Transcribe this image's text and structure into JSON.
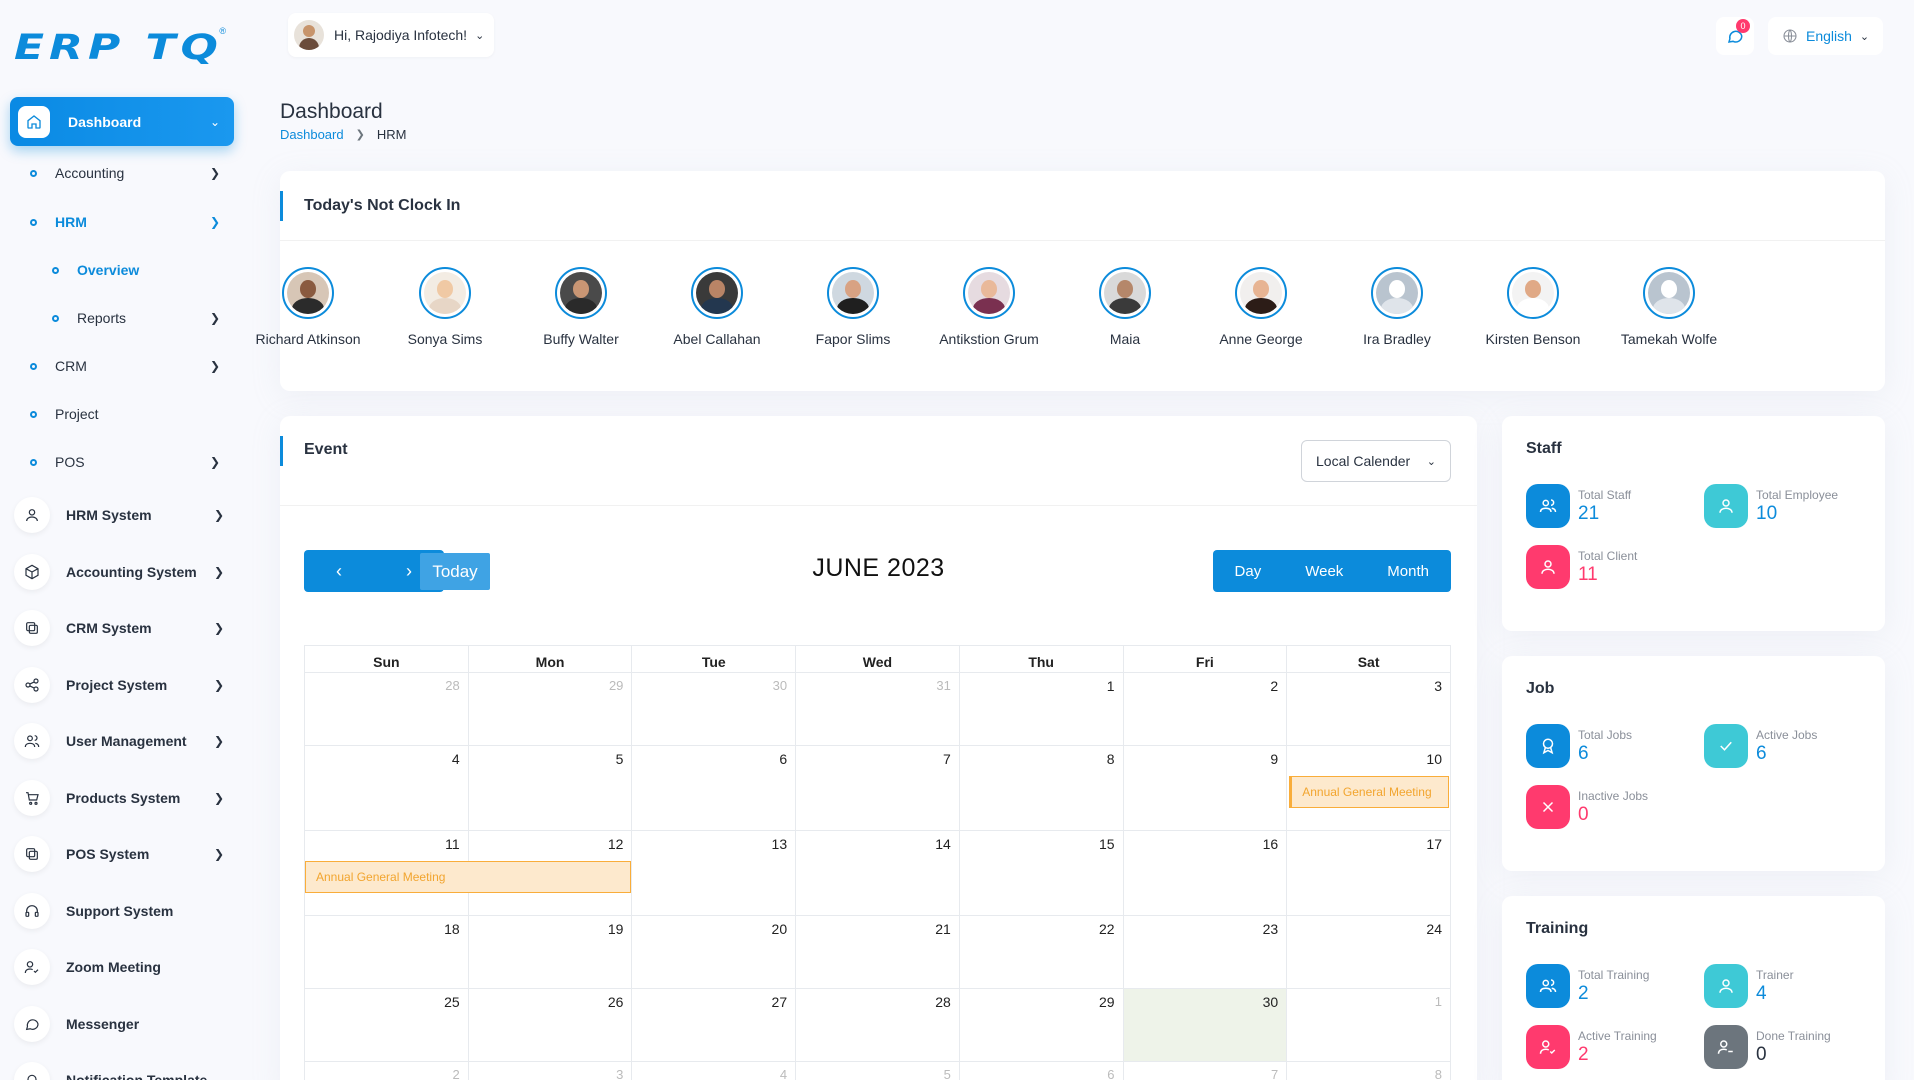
{
  "brand": {
    "logo_text": "ERP TQ",
    "reg": "®"
  },
  "sidebar": {
    "active": {
      "label": "Dashboard",
      "icon": "home-icon"
    },
    "subitems": [
      {
        "label": "Accounting",
        "chev": "›",
        "top": 0
      },
      {
        "label": "HRM",
        "chev": "⌄"
      },
      {
        "label": "Overview"
      },
      {
        "label": "Reports",
        "chev": "›"
      },
      {
        "label": "CRM",
        "chev": "›"
      },
      {
        "label": "Project"
      },
      {
        "label": "POS",
        "chev": "›"
      }
    ],
    "menus": [
      {
        "label": "HRM System",
        "icon": "user-icon"
      },
      {
        "label": "Accounting System",
        "icon": "box-icon"
      },
      {
        "label": "CRM System",
        "icon": "layers-icon"
      },
      {
        "label": "Project System",
        "icon": "share-icon"
      },
      {
        "label": "User Management",
        "icon": "users-icon"
      },
      {
        "label": "Products System",
        "icon": "cart-icon"
      },
      {
        "label": "POS System",
        "icon": "layers-icon"
      },
      {
        "label": "Support System",
        "icon": "headphones-icon"
      },
      {
        "label": "Zoom Meeting",
        "icon": "user-check-icon"
      },
      {
        "label": "Messenger",
        "icon": "message-icon"
      },
      {
        "label": "Notification Template",
        "icon": "bell-icon"
      }
    ]
  },
  "header": {
    "greeting": "Hi, Rajodiya Infotech!",
    "notification_count": "0",
    "language": "English"
  },
  "page": {
    "title": "Dashboard",
    "breadcrumb": [
      "Dashboard",
      "HRM"
    ]
  },
  "not_clock_in": {
    "title": "Today's Not Clock In",
    "people": [
      {
        "name": "Richard Atkinson",
        "skin": "#8a5a3f",
        "shirt": "#2b2b2b",
        "bg": "#d7c6b6"
      },
      {
        "name": "Sonya Sims",
        "skin": "#f0c9a4",
        "shirt": "#e7d6c6",
        "bg": "#f3ece3"
      },
      {
        "name": "Buffy Walter",
        "skin": "#c99674",
        "shirt": "#2a2a2a",
        "bg": "#4a4a4a"
      },
      {
        "name": "Abel Callahan",
        "skin": "#b98466",
        "shirt": "#23374f",
        "bg": "#3a3a3a"
      },
      {
        "name": "Fapor Slims",
        "skin": "#d8a283",
        "shirt": "#1f1f1f",
        "bg": "#cfd8e0"
      },
      {
        "name": "Antikstion Grum",
        "skin": "#e9b99a",
        "shirt": "#7a3050",
        "bg": "#e6dbe0"
      },
      {
        "name": "Maia",
        "skin": "#b5876a",
        "shirt": "#3a3a3a",
        "bg": "#d9d9d9"
      },
      {
        "name": "Anne George",
        "skin": "#e7b493",
        "shirt": "#2c1c17",
        "bg": "#f1efee"
      },
      {
        "name": "Ira Bradley",
        "skin": "#ffffff",
        "shirt": "#dfe4ea",
        "bg": "#b9c4cf"
      },
      {
        "name": "Kirsten Benson",
        "skin": "#e0a986",
        "shirt": "#ffffff",
        "bg": "#f3f3f3"
      },
      {
        "name": "Tamekah Wolfe",
        "skin": "#ffffff",
        "shirt": "#dfe4ea",
        "bg": "#b9c4cf"
      }
    ]
  },
  "event": {
    "title": "Event",
    "calendar_select": "Local Calender",
    "today_label": "Today",
    "month_title": "JUNE 2023",
    "views": [
      "Day",
      "Week",
      "Month"
    ],
    "weekdays": [
      "Sun",
      "Mon",
      "Tue",
      "Wed",
      "Thu",
      "Fri",
      "Sat"
    ],
    "weeks": [
      [
        "28",
        "29",
        "30",
        "31",
        "1",
        "2",
        "3"
      ],
      [
        "4",
        "5",
        "6",
        "7",
        "8",
        "9",
        "10"
      ],
      [
        "11",
        "12",
        "13",
        "14",
        "15",
        "16",
        "17"
      ],
      [
        "18",
        "19",
        "20",
        "21",
        "22",
        "23",
        "24"
      ],
      [
        "25",
        "26",
        "27",
        "28",
        "29",
        "30",
        "1"
      ],
      [
        "2",
        "3",
        "4",
        "5",
        "6",
        "7",
        "8"
      ]
    ],
    "events": [
      {
        "title": "Annual General Meeting",
        "week": 1,
        "start": 6,
        "span": 1
      },
      {
        "title": "Annual General Meeting",
        "week": 2,
        "start": 0,
        "span": 2
      }
    ]
  },
  "staff": {
    "title": "Staff",
    "items": [
      {
        "label": "Total Staff",
        "value": "21",
        "color": "blue"
      },
      {
        "label": "Total Employee",
        "value": "10",
        "color": "teal"
      },
      {
        "label": "Total Client",
        "value": "11",
        "color": "pink"
      }
    ]
  },
  "job": {
    "title": "Job",
    "items": [
      {
        "label": "Total Jobs",
        "value": "6",
        "color": "blue"
      },
      {
        "label": "Active Jobs",
        "value": "6",
        "color": "teal"
      },
      {
        "label": "Inactive Jobs",
        "value": "0",
        "color": "pink"
      }
    ]
  },
  "training": {
    "title": "Training",
    "items": [
      {
        "label": "Total Training",
        "value": "2",
        "color": "blue"
      },
      {
        "label": "Trainer",
        "value": "4",
        "color": "teal"
      },
      {
        "label": "Active Training",
        "value": "2",
        "color": "pink"
      },
      {
        "label": "Done Training",
        "value": "0",
        "color": "gray"
      }
    ]
  }
}
